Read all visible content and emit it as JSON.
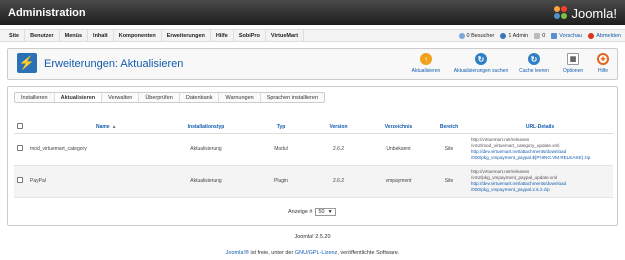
{
  "app": {
    "title": "Administration",
    "logo_text": "Joomla!"
  },
  "menu": {
    "items": [
      "Site",
      "Benutzer",
      "Menüs",
      "Inhalt",
      "Komponenten",
      "Erweiterungen",
      "Hilfe",
      "SobiPro",
      "VirtueMart"
    ]
  },
  "status": {
    "visitors": "0 Besucher",
    "admins": "1 Admin",
    "messages": "0",
    "preview": "Vorschau",
    "logout": "Abmelden"
  },
  "toolbar": {
    "page_title": "Erweiterungen: Aktualisieren",
    "buttons": {
      "update": "Aktualisieren",
      "find_updates": "Aktualisierungen suchen",
      "purge_cache": "Cache leeren",
      "options": "Optionen",
      "help": "Hilfe"
    }
  },
  "tabs": [
    "Installieren",
    "Aktualisieren",
    "Verwalten",
    "Überprüfen",
    "Datenbank",
    "Warnungen",
    "Sprachen installieren"
  ],
  "table": {
    "headers": {
      "name": "Name",
      "installation_type": "Installationstyp",
      "type": "Typ",
      "version": "Version",
      "folder": "Verzeichnis",
      "area": "Bereich",
      "url_details": "URL-Details"
    },
    "rows": [
      {
        "name": "mod_virtuemart_category",
        "installation_type": "Aktualisierung",
        "type": "Modul",
        "version": "2.6.2",
        "folder": "Unbekannt",
        "area": "Site",
        "url_line1": "http://virtuemart.net/releases",
        "url_line2": "/vm2/mod_virtuemart_category_update.xml",
        "url_line3": "http://dev.virtuemart.net/attachments/download",
        "url_line4": "/000/pkg_vmpayment_paypal.${PHING.VM.RELEASE}.zip"
      },
      {
        "name": "PayPal",
        "installation_type": "Aktualisierung",
        "type": "Plugin",
        "version": "2.6.2",
        "folder": "vmpayment",
        "area": "Site",
        "url_line1": "http://virtuemart.net/releases",
        "url_line2": "/vm2/pkg_vmpayment_paypal_update.xml",
        "url_line3": "http://dev.virtuemart.net/attachments/download",
        "url_line4": "/000/pkg_vmpayment_paypal.2.6.2.zip"
      }
    ]
  },
  "pagination": {
    "label": "Anzeige #",
    "value": "50"
  },
  "footer": {
    "version": "Joomla! 2.5.20",
    "brand": "Joomla!®",
    "text_mid": " ist freie, unter der ",
    "license": "GNU/GPL-Lizenz",
    "text_end": ", veröffentlichte Software."
  },
  "colors": {
    "accent": "#135cae",
    "topbar": "#2b2b2b"
  }
}
